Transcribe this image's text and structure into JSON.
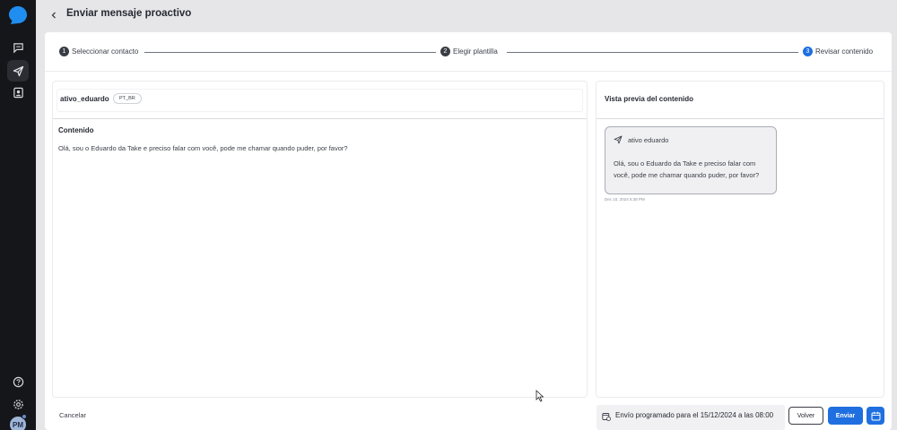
{
  "header": {
    "title": "Enviar mensaje proactivo"
  },
  "stepper": {
    "steps": [
      {
        "number": "1",
        "label": "Seleccionar contacto"
      },
      {
        "number": "2",
        "label": "Elegir plantilla"
      },
      {
        "number": "3",
        "label": "Revisar contenido"
      }
    ]
  },
  "template": {
    "name": "ativo_eduardo",
    "language": "PT_BR",
    "content_label": "Contenido",
    "content_text": "Olá, sou o Eduardo da Take e preciso falar com você, pode me chamar quando puder, por favor?"
  },
  "preview": {
    "title": "Vista previa del contenido",
    "sender": "ativo eduardo",
    "message": "Olá, sou o Eduardo da Take e preciso falar com você, pode me chamar quando puder, por favor?",
    "timestamp": "Dec 10, 2024 5:38 PM"
  },
  "footer": {
    "cancel_label": "Cancelar",
    "schedule_text": "Envío programado para el 15/12/2024 a las 08:00",
    "back_label": "Volver",
    "send_label": "Enviar"
  },
  "sidebar": {
    "avatar_initials": "PM",
    "icons": [
      "chat-icon",
      "send-icon",
      "contacts-icon",
      "help-icon",
      "settings-icon"
    ]
  },
  "colors": {
    "accent": "#1f6fe0",
    "sidebar": "#15161a",
    "background": "#e6e6e8"
  }
}
